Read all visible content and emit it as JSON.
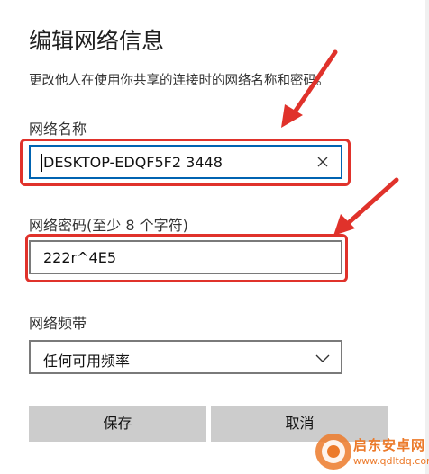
{
  "dialog": {
    "title": "编辑网络信息",
    "description": "更改他人在使用你共享的连接时的网络名称和密码。"
  },
  "network_name": {
    "label": "网络名称",
    "value": "DESKTOP-EDQF5F2 3448"
  },
  "network_password": {
    "label": "网络密码(至少 8 个字符)",
    "value": "222r^4E5"
  },
  "network_band": {
    "label": "网络频带",
    "selected": "任何可用频率"
  },
  "buttons": {
    "save": "保存",
    "cancel": "取消"
  },
  "watermark": {
    "name": "启东安卓网",
    "url": "www.qdltdq.com"
  },
  "colors": {
    "focus_border": "#0063b1",
    "highlight": "#e0322b",
    "button_bg": "#cccccc",
    "watermark": "#ec7a2a"
  },
  "icons": {
    "clear": "close-icon",
    "dropdown": "chevron-down-icon",
    "annotation": "arrow-icon"
  }
}
